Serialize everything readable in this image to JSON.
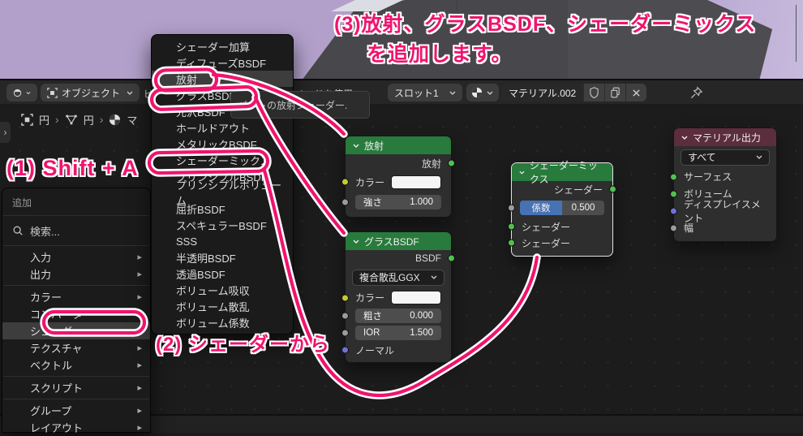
{
  "colors": {
    "accent_pink": "#f0146e",
    "shader_header_green": "#287b3c",
    "output_header_maroon": "#5c2d3d",
    "fac_blue": "#4772b3",
    "viewport_purple": "#b2a0ca"
  },
  "icons": {
    "submenu_arrow": "▸",
    "breadcrumb_sep": "›",
    "panel_toggle": "›"
  },
  "annotations": {
    "step1": "(1) Shift + A",
    "step2": "(2) シェーダーから",
    "step3_line1": "(3)放射、グラスBSDF、シェーダーミックス",
    "step3_line2": "を追加します。"
  },
  "editor_header": {
    "mode": "オブジェクト",
    "menu_partial": "ビ",
    "use_nodes": "ノードを使用",
    "slot": "スロット1",
    "material_name": "マテリアル.002",
    "tooltip": "バートの放射シェーダー."
  },
  "breadcrumb": {
    "object_name": "円",
    "mesh_name": "円",
    "material_partial": "マ"
  },
  "add_menu": {
    "title": "追加",
    "search": "検索...",
    "groups": [
      [
        "入力",
        "出力"
      ],
      [
        "カラー",
        "コンバーター",
        "シェーダー",
        "テクスチャ",
        "ベクトル"
      ],
      [
        "スクリプト"
      ],
      [
        "グループ",
        "レイアウト"
      ]
    ]
  },
  "shader_menu": {
    "items": [
      "シェーダー加算",
      "ディフューズBSDF",
      "放射",
      "グラスBSDF",
      "光沢BSDF",
      "ホールドアウト",
      "メタリックBSDF",
      "シェーダーミックス",
      "プリンシプルBSDF",
      "プリンシプルボリューム",
      "屈折BSDF",
      "スペキュラーBSDF",
      "SSS",
      "半透明BSDF",
      "透過BSDF",
      "ボリューム吸収",
      "ボリューム散乱",
      "ボリューム係数"
    ]
  },
  "nodes": {
    "emission": {
      "title": "放射",
      "output": "放射",
      "color_label": "カラー",
      "strength_label": "強さ",
      "strength_value": "1.000"
    },
    "glass": {
      "title": "グラスBSDF",
      "output": "BSDF",
      "distribution": "複合散乱GGX",
      "color_label": "カラー",
      "roughness_label": "粗さ",
      "roughness_value": "0.000",
      "ior_label": "IOR",
      "ior_value": "1.500",
      "normal_label": "ノーマル"
    },
    "mix": {
      "title": "シェーダーミックス",
      "output": "シェーダー",
      "fac_label": "係数",
      "fac_value": "0.500",
      "input1": "シェーダー",
      "input2": "シェーダー"
    },
    "output": {
      "title": "マテリアル出力",
      "target": "すべて",
      "surface": "サーフェス",
      "volume": "ボリューム",
      "displacement": "ディスプレイスメント",
      "thickness": "幅"
    }
  }
}
